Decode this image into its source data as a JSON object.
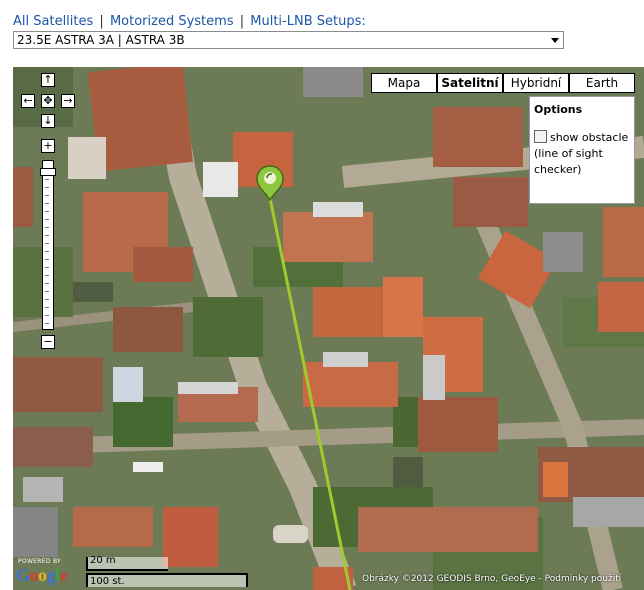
{
  "nav": {
    "link_all": "All Satellites",
    "sep1": "|",
    "link_motorized": "Motorized Systems",
    "sep2": "|",
    "link_multilnb": "Multi-LNB Setups:"
  },
  "satellite_select": {
    "value": "23.5E ASTRA 3A | ASTRA 3B"
  },
  "map": {
    "pan_up": "↑",
    "pan_left": "←",
    "pan_center": "✥",
    "pan_right": "→",
    "pan_down": "↓",
    "zoom_in": "+",
    "zoom_out": "−",
    "types": [
      "Mapa",
      "Satelitní",
      "Hybridní",
      "Earth"
    ],
    "active_type": "Satelitní",
    "options": {
      "title": "Options",
      "checkbox_label": "show obstacle",
      "checkbox_label_2": "(line of sight",
      "checkbox_label_3": "checker)",
      "checked": false
    },
    "scale_metric": "20 m",
    "scale_imperial": "100 st.",
    "copyright": "Obrázky ©2012 GEODIS Brno, GeoEye - Podmínky použití",
    "logo_powered": "POWERED BY",
    "logo": "Google",
    "colors": {
      "los_line": "#9ecb2d",
      "marker": "#8ec63f"
    }
  }
}
